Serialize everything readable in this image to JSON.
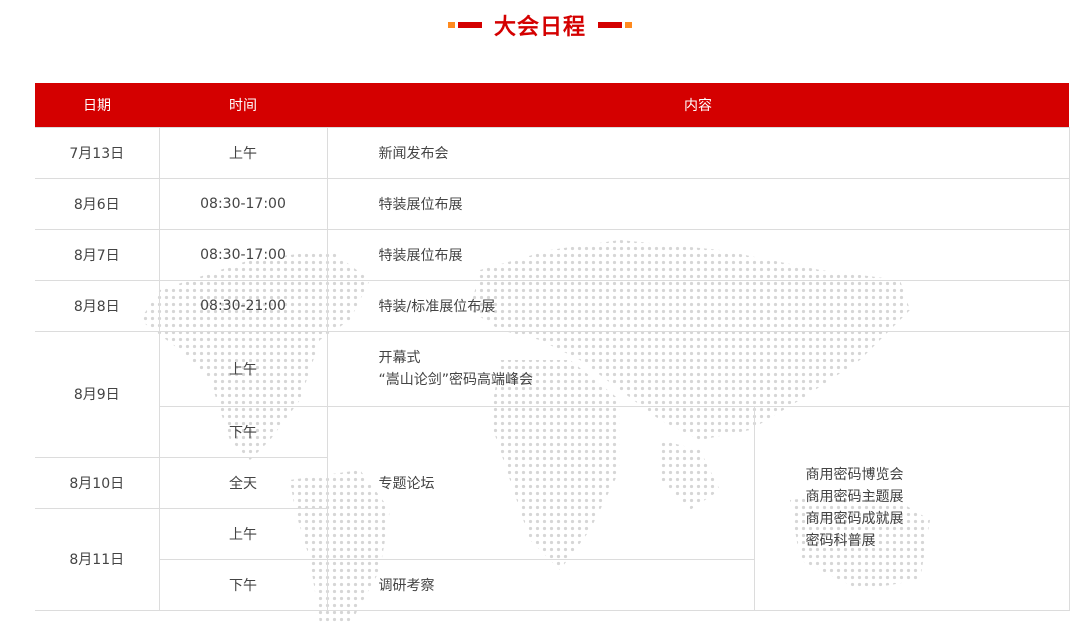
{
  "page": {
    "title": "大会日程"
  },
  "colors": {
    "accent": "#d40000",
    "accent_secondary": "#ff8a1f",
    "border": "#dcdcdc"
  },
  "table": {
    "headers": {
      "date": "日期",
      "time": "时间",
      "content": "内容"
    },
    "rows": [
      {
        "date": "7月13日",
        "time": "上午",
        "content": "新闻发布会"
      },
      {
        "date": "8月6日",
        "time": "08:30-17:00",
        "content": "特装展位布展"
      },
      {
        "date": "8月7日",
        "time": "08:30-17:00",
        "content": "特装展位布展"
      },
      {
        "date": "8月8日",
        "time": "08:30-21:00",
        "content": "特装/标准展位布展"
      }
    ],
    "aug9": {
      "date": "8月9日",
      "morning_time": "上午",
      "morning_content_line1": "开幕式",
      "morning_content_line2": "“嵩山论剑”密码高端峰会",
      "afternoon_time": "下午"
    },
    "aug10": {
      "date": "8月10日",
      "time": "全天"
    },
    "aug11": {
      "date": "8月11日",
      "morning_time": "上午",
      "afternoon_time": "下午",
      "afternoon_content": "调研考察"
    },
    "forum": "专题论坛",
    "expo": [
      "商用密码博览会",
      "商用密码主题展",
      "商用密码成就展",
      "密码科普展"
    ]
  }
}
